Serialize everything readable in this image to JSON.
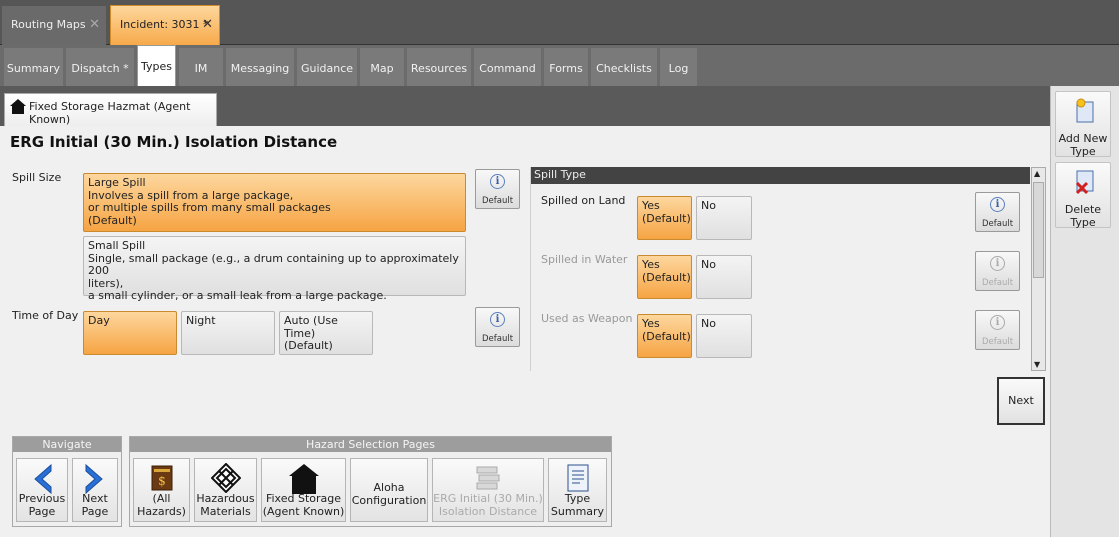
{
  "doc_tabs": [
    {
      "label": "Routing Maps",
      "close": "✕"
    },
    {
      "label": "Incident: 3031 *",
      "close": "✕"
    }
  ],
  "section_tabs": [
    "Summary",
    "Dispatch *",
    "Types",
    "IM",
    "Messaging",
    "Guidance",
    "Map",
    "Resources",
    "Command",
    "Forms",
    "Checklists",
    "Log"
  ],
  "active_section": "Types",
  "sub_tab": "Fixed Storage Hazmat (Agent Known)",
  "title": "ERG Initial (30 Min.) Isolation Distance",
  "spill_size": {
    "label": "Spill Size",
    "large": {
      "title": "Large Spill",
      "l1": "Involves a spill from a large package,",
      "l2": "or multiple spills from many small packages",
      "l3": "(Default)"
    },
    "small": {
      "title": "Small Spill",
      "l1": "Single, small package (e.g., a drum containing up to approximately 200",
      "l2": "liters),",
      "l3": "a small cylinder, or a small leak from a large package."
    }
  },
  "time_of_day": {
    "label": "Time of Day",
    "day": "Day",
    "night": "Night",
    "auto1": "Auto (Use Time)",
    "auto2": "(Default)"
  },
  "default_label": "Default",
  "info_glyph": "i",
  "spill_type": {
    "header": "Spill Type",
    "rows": [
      {
        "label": "Spilled on Land",
        "yes1": "Yes",
        "yes2": "(Default)",
        "no": "No"
      },
      {
        "label": "Spilled in Water",
        "yes1": "Yes",
        "yes2": "(Default)",
        "no": "No"
      },
      {
        "label": "Used as Weapon",
        "yes1": "Yes",
        "yes2": "(Default)",
        "no": "No"
      }
    ]
  },
  "next": "Next",
  "side": {
    "add1": "Add New",
    "add2": "Type",
    "del1": "Delete",
    "del2": "Type"
  },
  "navigate": {
    "header": "Navigate",
    "prev1": "Previous",
    "prev2": "Page",
    "next1": "Next",
    "next2": "Page"
  },
  "hazard_pages": {
    "header": "Hazard Selection Pages",
    "all1": "(All",
    "all2": "Hazards)",
    "haz1": "Hazardous",
    "haz2": "Materials",
    "fixed1": "Fixed Storage",
    "fixed2": "(Agent Known)",
    "aloha1": "Aloha",
    "aloha2": "Configuration",
    "erg1": "ERG Initial (30 Min.)",
    "erg2": "Isolation Distance",
    "type1": "Type",
    "type2": "Summary"
  },
  "colors": {
    "accent_orange": "#f6a443",
    "dark_bar": "#565656",
    "arrow_blue": "#2a6fd6"
  }
}
